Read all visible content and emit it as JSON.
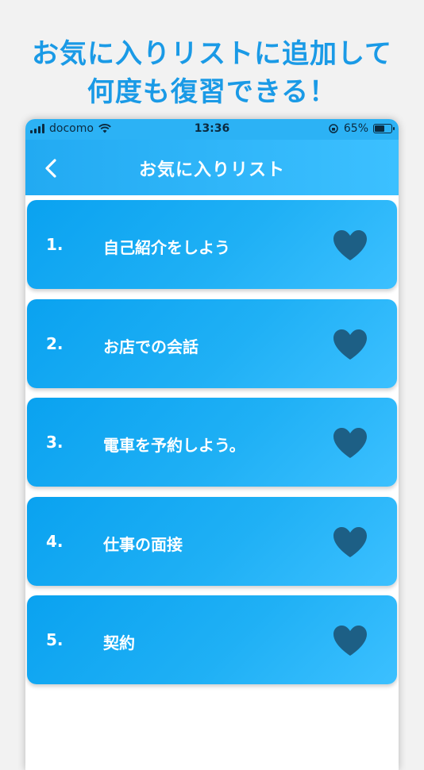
{
  "promo": {
    "line1": "お気に入りリストに追加して",
    "line2": "何度も復習できる！"
  },
  "status": {
    "carrier": "docomo",
    "time": "13:36",
    "battery_text": "65%",
    "battery_level": 0.65
  },
  "nav": {
    "back_icon": "chevron-left-icon",
    "title": "お気に入りリスト"
  },
  "colors": {
    "accent": "#1fb0f5",
    "heart": "#1d5f85",
    "promo_text": "#1a9ae6"
  },
  "favorites": [
    {
      "number": "1.",
      "title": "自己紹介をしよう",
      "icon": "heart-icon"
    },
    {
      "number": "2.",
      "title": "お店での会話",
      "icon": "heart-icon"
    },
    {
      "number": "3.",
      "title": "電車を予約しよう。",
      "icon": "heart-icon"
    },
    {
      "number": "4.",
      "title": "仕事の面接",
      "icon": "heart-icon"
    },
    {
      "number": "5.",
      "title": "契約",
      "icon": "heart-icon"
    }
  ]
}
